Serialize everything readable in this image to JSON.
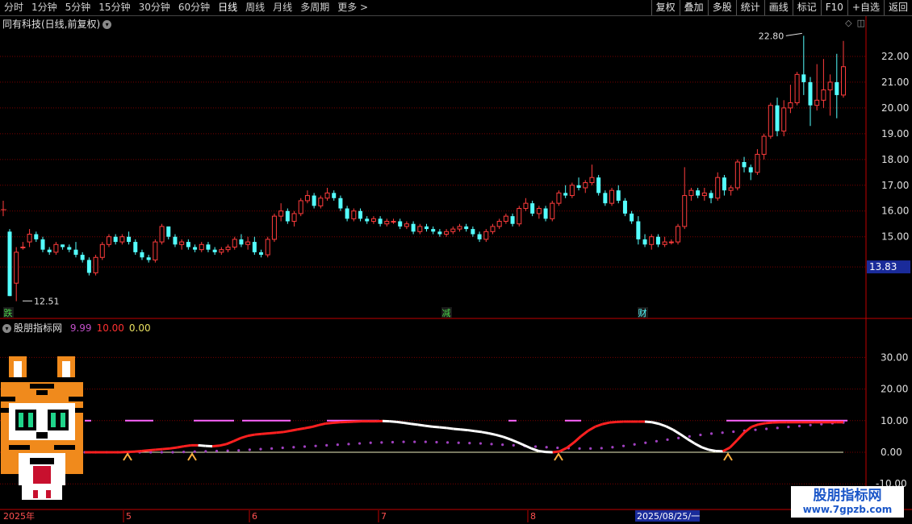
{
  "toolbar": {
    "periods": [
      "分时",
      "1分钟",
      "5分钟",
      "15分钟",
      "30分钟",
      "60分钟",
      "日线",
      "周线",
      "月线",
      "多周期",
      "更多 >"
    ],
    "active_period": "日线",
    "right_buttons": [
      "复权",
      "叠加",
      "多股",
      "统计",
      "画线",
      "F10",
      "+自选",
      "返回"
    ],
    "mark_label": "标记"
  },
  "header": {
    "stock_title": "同有科技(日线,前复权)"
  },
  "price_axis": {
    "ticks": [
      "22.00",
      "21.00",
      "20.00",
      "19.00",
      "18.00",
      "17.00",
      "16.00",
      "15.00"
    ],
    "current_price": "13.83"
  },
  "annotations": {
    "high": "22.80",
    "low": "12.51",
    "event_markers": [
      "跌",
      "减",
      "财"
    ]
  },
  "indicator": {
    "name": "股朋指标网",
    "values": [
      "9.99",
      "10.00",
      "0.00"
    ],
    "value_colors": [
      "#c050c8",
      "#ff3030",
      "#e8e060"
    ],
    "axis_ticks": [
      "30.00",
      "20.00",
      "10.00",
      "0.00",
      "-10.00"
    ]
  },
  "time_axis": {
    "labels": [
      "2025年",
      "5",
      "6",
      "7",
      "8",
      "2025/08/25/一"
    ]
  },
  "colors": {
    "up": "#ff3c3c",
    "down": "#54ffff",
    "grid": "#7a0000",
    "axis": "#c00000"
  },
  "chart_data": {
    "type": "candlestick",
    "ylim": [
      12.3,
      23.0
    ],
    "candles": [
      [
        15.2,
        15.3,
        12.7,
        12.7
      ],
      [
        13.2,
        14.6,
        12.5,
        14.4
      ],
      [
        14.6,
        14.8,
        14.5,
        14.6
      ],
      [
        14.8,
        15.3,
        14.6,
        15.1
      ],
      [
        15.1,
        15.2,
        14.8,
        14.9
      ],
      [
        14.9,
        15.0,
        14.4,
        14.5
      ],
      [
        14.5,
        14.6,
        14.3,
        14.4
      ],
      [
        14.4,
        14.8,
        14.3,
        14.7
      ],
      [
        14.7,
        14.7,
        14.5,
        14.6
      ],
      [
        14.6,
        14.7,
        14.4,
        14.5
      ],
      [
        14.5,
        14.8,
        14.2,
        14.3
      ],
      [
        14.3,
        14.4,
        14.0,
        14.1
      ],
      [
        14.1,
        14.2,
        13.5,
        13.6
      ],
      [
        13.6,
        14.3,
        13.5,
        14.2
      ],
      [
        14.2,
        14.8,
        14.1,
        14.7
      ],
      [
        14.7,
        15.1,
        14.6,
        15.0
      ],
      [
        15.0,
        15.1,
        14.7,
        14.8
      ],
      [
        14.8,
        15.1,
        14.7,
        15.0
      ],
      [
        15.0,
        15.2,
        14.7,
        14.8
      ],
      [
        14.8,
        14.9,
        14.3,
        14.4
      ],
      [
        14.4,
        14.5,
        14.1,
        14.2
      ],
      [
        14.2,
        14.3,
        14.0,
        14.1
      ],
      [
        14.1,
        14.9,
        14.0,
        14.8
      ],
      [
        14.8,
        15.5,
        14.7,
        15.4
      ],
      [
        15.4,
        15.4,
        14.9,
        15.0
      ],
      [
        15.0,
        15.1,
        14.6,
        14.7
      ],
      [
        14.7,
        14.9,
        14.5,
        14.8
      ],
      [
        14.8,
        14.9,
        14.5,
        14.6
      ],
      [
        14.6,
        14.7,
        14.4,
        14.5
      ],
      [
        14.5,
        14.8,
        14.4,
        14.7
      ],
      [
        14.7,
        14.8,
        14.4,
        14.5
      ],
      [
        14.5,
        14.6,
        14.3,
        14.4
      ],
      [
        14.4,
        14.6,
        14.3,
        14.5
      ],
      [
        14.5,
        14.7,
        14.4,
        14.6
      ],
      [
        14.6,
        15.0,
        14.5,
        14.9
      ],
      [
        14.9,
        15.1,
        14.6,
        14.7
      ],
      [
        14.7,
        15.0,
        14.5,
        14.8
      ],
      [
        14.8,
        15.0,
        14.3,
        14.4
      ],
      [
        14.4,
        14.5,
        14.2,
        14.3
      ],
      [
        14.3,
        15.0,
        14.2,
        14.9
      ],
      [
        14.9,
        15.9,
        14.8,
        15.8
      ],
      [
        15.8,
        16.3,
        15.6,
        16.0
      ],
      [
        16.0,
        16.1,
        15.5,
        15.6
      ],
      [
        15.6,
        16.0,
        15.4,
        15.9
      ],
      [
        15.9,
        16.5,
        15.8,
        16.4
      ],
      [
        16.4,
        16.8,
        16.3,
        16.6
      ],
      [
        16.6,
        16.7,
        16.1,
        16.2
      ],
      [
        16.2,
        16.6,
        16.1,
        16.5
      ],
      [
        16.5,
        16.9,
        16.4,
        16.7
      ],
      [
        16.7,
        16.8,
        16.4,
        16.5
      ],
      [
        16.5,
        16.6,
        16.0,
        16.1
      ],
      [
        16.1,
        16.2,
        15.6,
        15.7
      ],
      [
        15.7,
        16.1,
        15.6,
        16.0
      ],
      [
        16.0,
        16.1,
        15.6,
        15.7
      ],
      [
        15.7,
        15.8,
        15.5,
        15.6
      ],
      [
        15.6,
        15.8,
        15.5,
        15.7
      ],
      [
        15.7,
        15.8,
        15.4,
        15.5
      ],
      [
        15.5,
        15.7,
        15.4,
        15.6
      ],
      [
        15.6,
        15.7,
        15.5,
        15.6
      ],
      [
        15.6,
        15.7,
        15.3,
        15.4
      ],
      [
        15.4,
        15.6,
        15.3,
        15.5
      ],
      [
        15.5,
        15.6,
        15.1,
        15.2
      ],
      [
        15.2,
        15.5,
        15.1,
        15.4
      ],
      [
        15.4,
        15.5,
        15.2,
        15.3
      ],
      [
        15.3,
        15.4,
        15.1,
        15.2
      ],
      [
        15.2,
        15.3,
        15.0,
        15.1
      ],
      [
        15.1,
        15.3,
        15.0,
        15.2
      ],
      [
        15.2,
        15.4,
        15.1,
        15.3
      ],
      [
        15.3,
        15.5,
        15.2,
        15.4
      ],
      [
        15.4,
        15.5,
        15.2,
        15.3
      ],
      [
        15.3,
        15.4,
        15.0,
        15.1
      ],
      [
        15.1,
        15.2,
        14.8,
        14.9
      ],
      [
        14.9,
        15.3,
        14.8,
        15.2
      ],
      [
        15.2,
        15.5,
        15.1,
        15.4
      ],
      [
        15.4,
        15.7,
        15.3,
        15.6
      ],
      [
        15.6,
        15.9,
        15.5,
        15.8
      ],
      [
        15.8,
        15.9,
        15.4,
        15.5
      ],
      [
        15.5,
        16.2,
        15.4,
        16.1
      ],
      [
        16.1,
        16.5,
        16.0,
        16.3
      ],
      [
        16.3,
        16.4,
        15.8,
        15.9
      ],
      [
        15.9,
        16.2,
        15.7,
        16.1
      ],
      [
        16.1,
        16.2,
        15.6,
        15.7
      ],
      [
        15.7,
        16.4,
        15.6,
        16.3
      ],
      [
        16.3,
        16.8,
        16.2,
        16.7
      ],
      [
        16.7,
        17.0,
        16.5,
        16.6
      ],
      [
        16.6,
        17.1,
        16.5,
        17.0
      ],
      [
        17.0,
        17.3,
        16.8,
        16.9
      ],
      [
        16.9,
        17.2,
        16.7,
        17.1
      ],
      [
        17.1,
        17.8,
        17.0,
        17.3
      ],
      [
        17.3,
        17.4,
        16.6,
        16.7
      ],
      [
        16.7,
        16.8,
        16.2,
        16.3
      ],
      [
        16.3,
        16.9,
        16.2,
        16.8
      ],
      [
        16.8,
        17.0,
        16.3,
        16.4
      ],
      [
        16.4,
        16.5,
        15.8,
        15.9
      ],
      [
        15.9,
        16.0,
        15.5,
        15.6
      ],
      [
        15.6,
        15.8,
        14.7,
        14.9
      ],
      [
        14.9,
        15.1,
        14.6,
        14.7
      ],
      [
        14.7,
        15.1,
        14.5,
        15.0
      ],
      [
        15.0,
        15.1,
        14.6,
        14.7
      ],
      [
        14.7,
        15.0,
        14.6,
        14.8
      ],
      [
        14.8,
        14.9,
        14.7,
        14.8
      ],
      [
        14.8,
        15.5,
        14.7,
        15.4
      ],
      [
        15.4,
        17.7,
        15.3,
        16.6
      ],
      [
        16.6,
        16.9,
        16.4,
        16.8
      ],
      [
        16.8,
        16.9,
        16.5,
        16.6
      ],
      [
        16.6,
        16.9,
        16.4,
        16.7
      ],
      [
        16.7,
        16.8,
        16.3,
        16.5
      ],
      [
        16.5,
        17.5,
        16.4,
        17.3
      ],
      [
        17.3,
        17.4,
        16.6,
        16.8
      ],
      [
        16.8,
        17.0,
        16.6,
        16.9
      ],
      [
        16.9,
        18.0,
        16.8,
        17.9
      ],
      [
        17.9,
        18.1,
        17.5,
        17.7
      ],
      [
        17.7,
        17.8,
        17.2,
        17.5
      ],
      [
        17.5,
        18.4,
        17.4,
        18.2
      ],
      [
        18.2,
        19.0,
        18.0,
        18.9
      ],
      [
        18.9,
        20.2,
        18.8,
        20.1
      ],
      [
        20.1,
        20.4,
        18.9,
        19.1
      ],
      [
        19.1,
        20.3,
        18.9,
        20.0
      ],
      [
        20.0,
        20.9,
        19.8,
        20.2
      ],
      [
        20.2,
        21.4,
        20.1,
        21.3
      ],
      [
        21.3,
        22.8,
        20.5,
        21.0
      ],
      [
        21.0,
        21.2,
        19.3,
        20.1
      ],
      [
        20.1,
        21.7,
        19.9,
        20.3
      ],
      [
        20.3,
        21.9,
        20.0,
        20.7
      ],
      [
        20.7,
        21.3,
        19.7,
        21.0
      ],
      [
        21.0,
        22.1,
        19.6,
        20.5
      ],
      [
        20.5,
        22.6,
        20.4,
        21.6
      ]
    ],
    "indicator_ylim": [
      -13,
      38
    ],
    "indicator_series": [
      {
        "values": [
          0,
          0,
          0,
          0,
          0,
          0,
          0.1,
          0.2,
          0.4,
          0.6,
          0.8,
          1.0,
          1.2,
          1.5,
          1.9,
          2.2,
          2.2,
          2.0,
          1.9,
          2.1,
          2.6,
          3.5,
          4.5,
          5.2,
          5.6,
          5.8,
          6.0,
          6.2,
          6.4,
          6.8,
          7.2,
          7.6,
          8.0,
          8.6,
          9.1,
          9.3,
          9.5,
          9.6,
          9.7,
          9.8,
          9.8,
          9.8,
          9.9,
          9.8,
          9.6,
          9.3,
          9.0,
          8.7,
          8.4,
          8.1,
          7.9,
          7.7,
          7.4,
          7.2,
          7.0,
          6.7,
          6.4,
          6.0,
          5.5,
          4.9,
          4.1,
          3.2,
          2.2,
          1.2,
          0.4,
          0.1,
          0.0,
          0.3,
          1.4,
          3.1,
          5.1,
          6.8,
          8.1,
          8.9,
          9.4,
          9.6,
          9.7,
          9.7,
          9.7,
          9.7,
          9.5,
          9.0,
          8.2,
          7.1,
          5.7,
          4.2,
          2.8,
          1.6,
          0.8,
          0.4,
          0.3,
          1.5,
          3.8,
          6.2,
          8.0,
          8.8,
          9.2,
          9.4,
          9.5,
          9.5,
          9.5,
          9.5,
          9.5,
          9.5,
          9.5,
          9.5,
          9.5,
          9.5
        ]
      },
      {
        "values": [
          0,
          0,
          0,
          0,
          0,
          0,
          0,
          0,
          0,
          0.1,
          0.2,
          0.3,
          0.4,
          0.5,
          0.6,
          0.8,
          1.0,
          1.2,
          1.4,
          1.6,
          1.8,
          2.0,
          2.2,
          2.4,
          2.6,
          2.8,
          3.0,
          3.1,
          3.2,
          3.3,
          3.3,
          3.3,
          3.2,
          3.1,
          3.0,
          2.9,
          2.8,
          2.6,
          2.4,
          2.2,
          2.0,
          1.8,
          1.6,
          1.4,
          1.3,
          1.2,
          1.2,
          1.3,
          1.6,
          2.0,
          2.5,
          3.0,
          3.5,
          4.0,
          4.5,
          5.0,
          5.5,
          5.9,
          6.2,
          6.5,
          6.8,
          7.1,
          7.4,
          7.7,
          8.0,
          8.3,
          8.6,
          8.9,
          9.2,
          9.4
        ]
      }
    ]
  }
}
